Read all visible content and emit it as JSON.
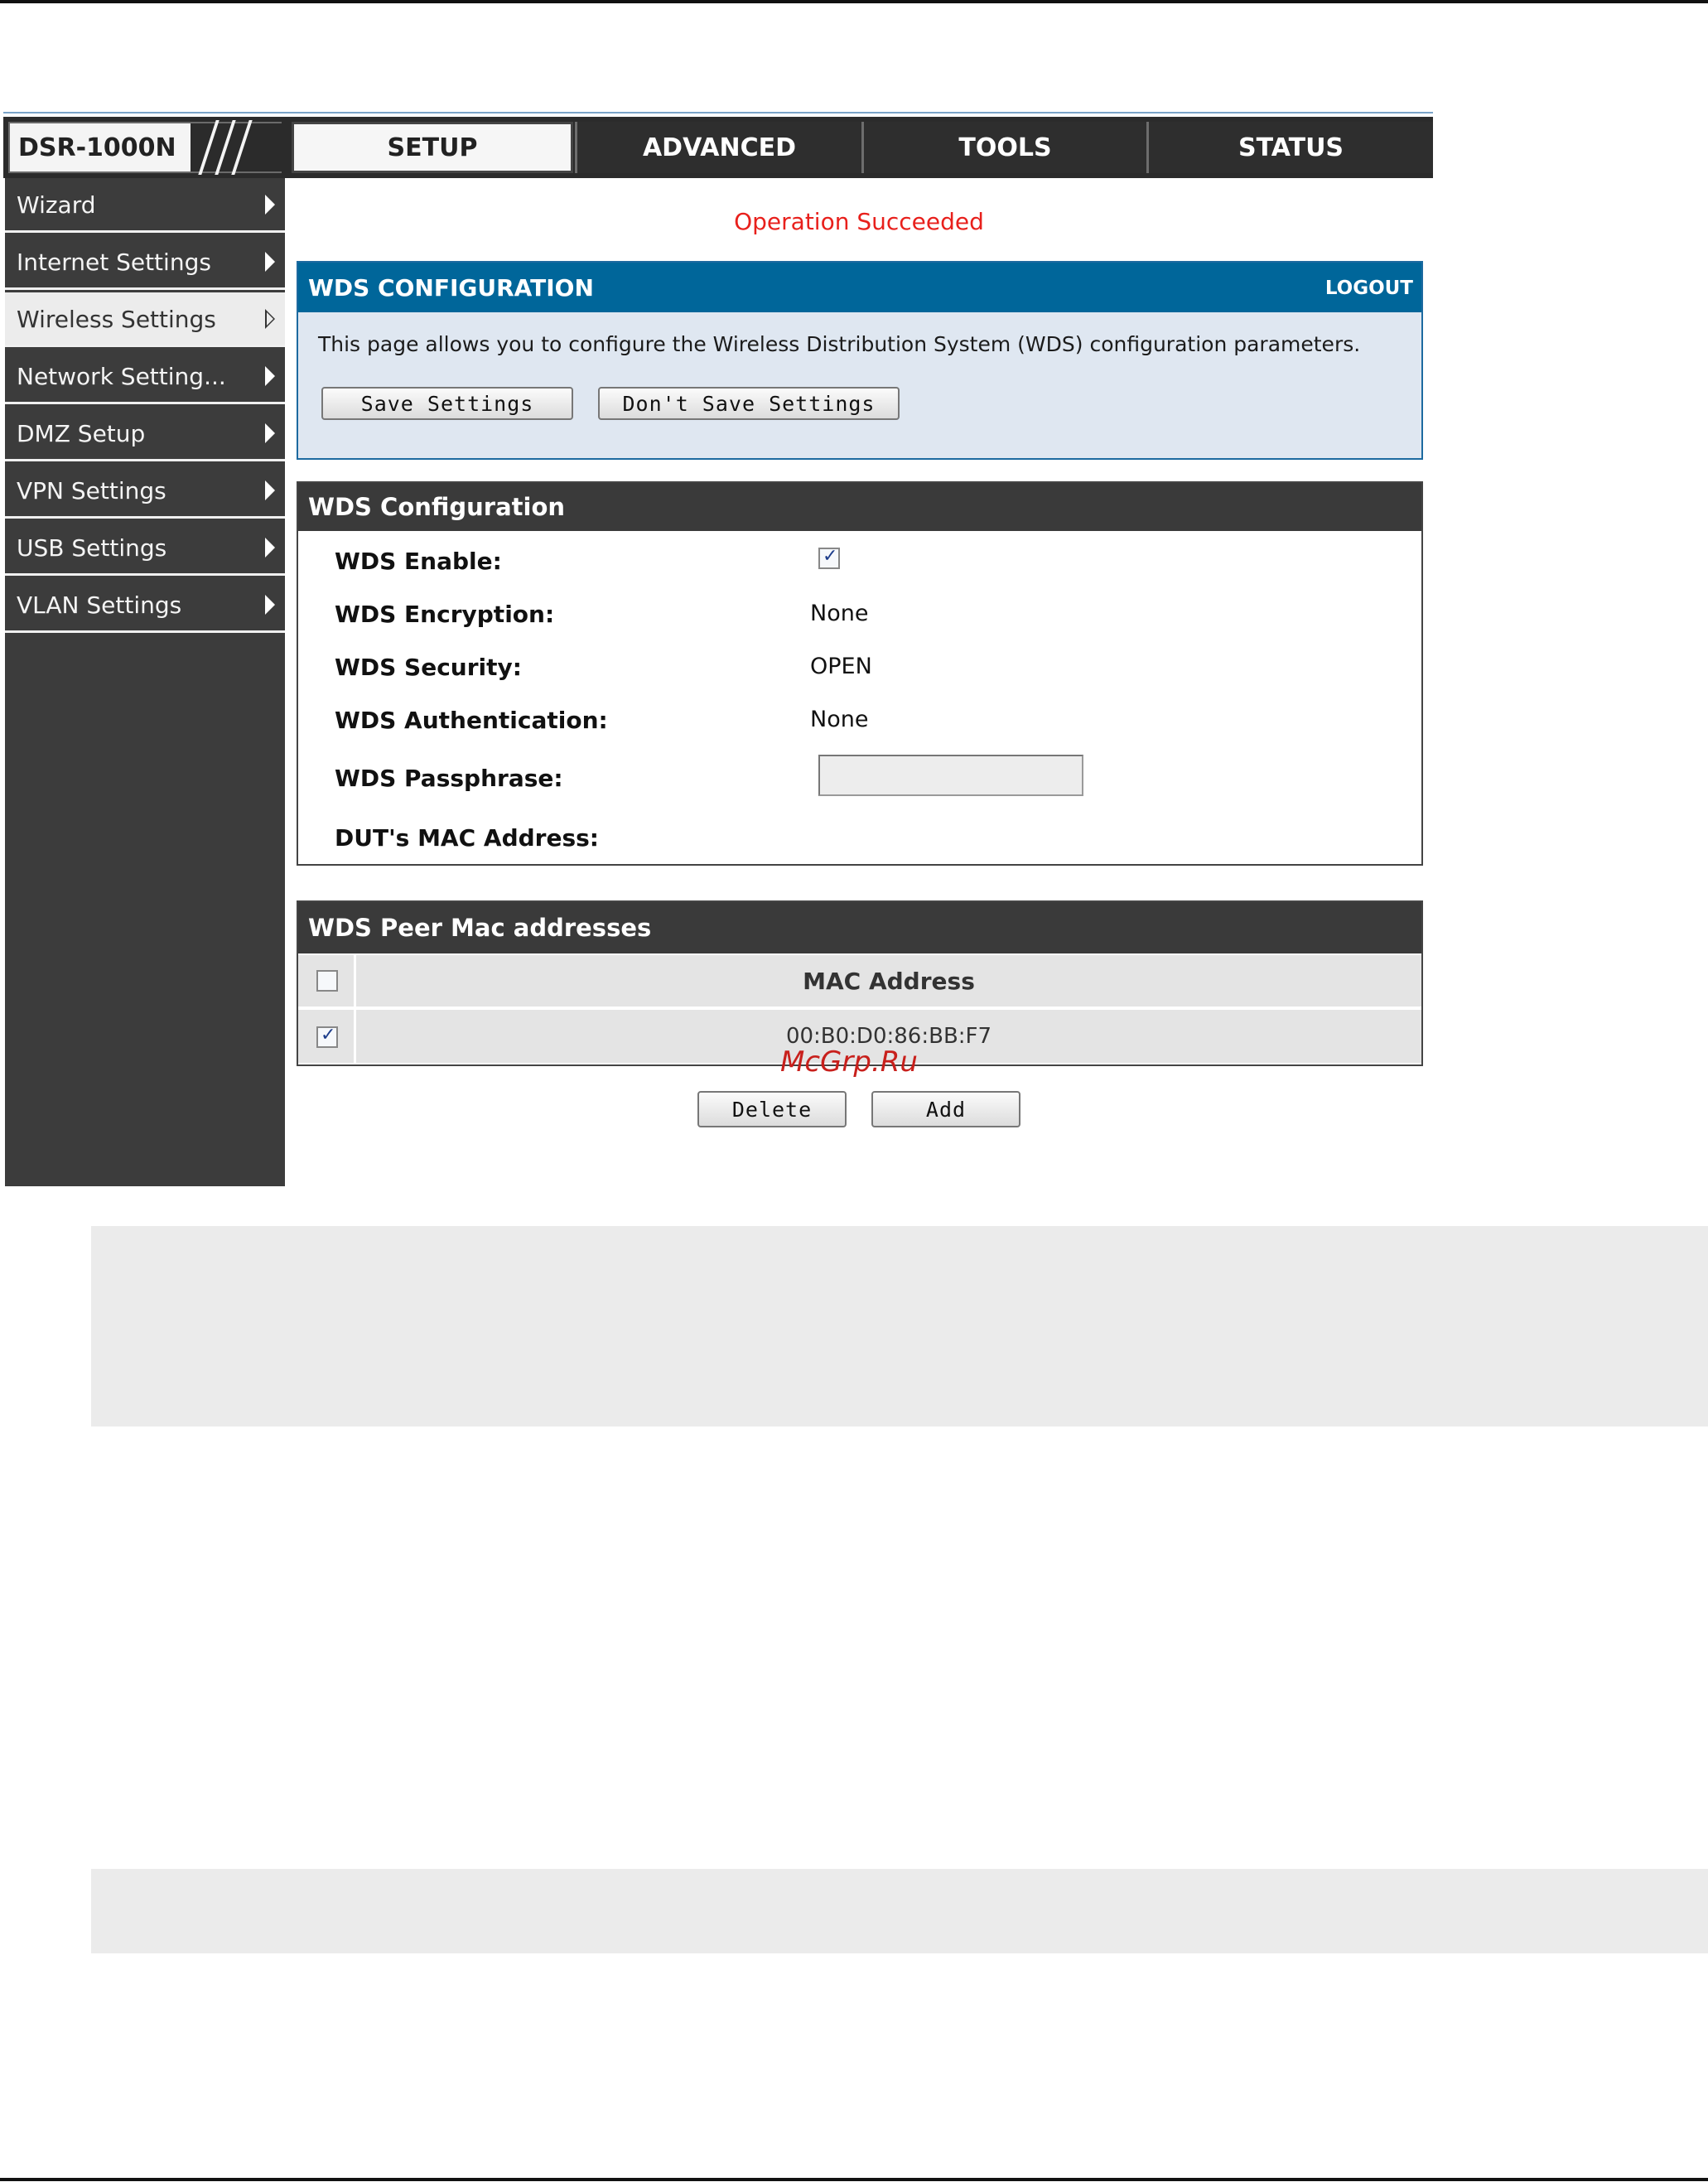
{
  "brand": {
    "name": "DSR-1000N"
  },
  "tabs": [
    {
      "label": "SETUP",
      "active": true
    },
    {
      "label": "ADVANCED",
      "active": false
    },
    {
      "label": "TOOLS",
      "active": false
    },
    {
      "label": "STATUS",
      "active": false
    }
  ],
  "sidebar": {
    "items": [
      {
        "label": "Wizard",
        "active": false
      },
      {
        "label": "Internet Settings",
        "active": false
      },
      {
        "label": "Wireless Settings",
        "active": true
      },
      {
        "label": "Network Setting...",
        "active": false
      },
      {
        "label": "DMZ Setup",
        "active": false
      },
      {
        "label": "VPN Settings",
        "active": false
      },
      {
        "label": "USB Settings",
        "active": false
      },
      {
        "label": "VLAN Settings",
        "active": false
      }
    ]
  },
  "status_message": "Operation Succeeded",
  "wds_header": {
    "title": "WDS CONFIGURATION",
    "logout": "LOGOUT",
    "description": "This page allows you to configure the Wireless Distribution System (WDS) configuration parameters.",
    "save_label": "Save Settings",
    "dont_save_label": "Don't Save Settings"
  },
  "wds_config": {
    "title": "WDS Configuration",
    "enable_label": "WDS Enable:",
    "enable_checked": true,
    "encryption_label": "WDS Encryption:",
    "encryption_value": "None",
    "security_label": "WDS Security:",
    "security_value": "OPEN",
    "authentication_label": "WDS Authentication:",
    "authentication_value": "None",
    "passphrase_label": "WDS Passphrase:",
    "passphrase_value": "",
    "mac_label": "DUT's MAC Address:"
  },
  "peer_table": {
    "title": "WDS Peer Mac addresses",
    "column_header": "MAC Address",
    "rows": [
      {
        "mac": "00:B0:D0:86:BB:F7",
        "checked": true
      }
    ],
    "delete_label": "Delete",
    "add_label": "Add"
  },
  "watermark": "McGrp.Ru",
  "colors": {
    "status_red": "#e8201c",
    "header_blue": "#00669a",
    "dark_bar": "#3a3a3a"
  }
}
